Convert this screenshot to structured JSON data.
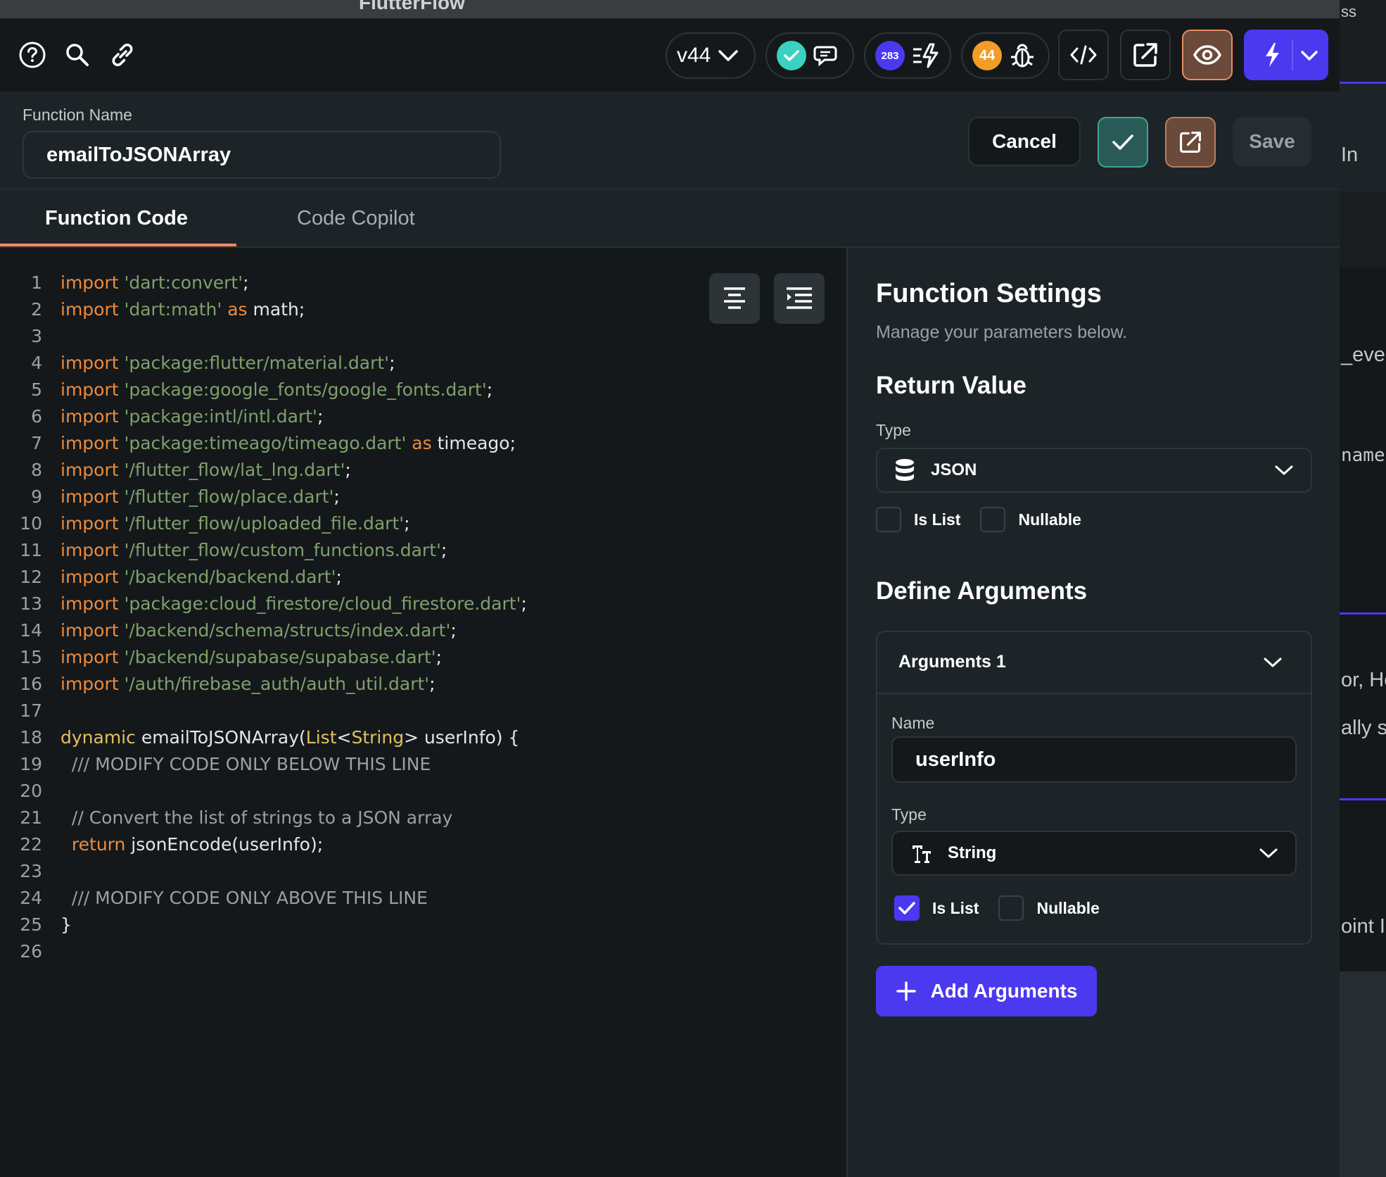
{
  "window": {
    "title": "FlutterFlow"
  },
  "toolbar": {
    "version": "v44",
    "issues_count": "283",
    "bugs_count": "44"
  },
  "function": {
    "name_label": "Function Name",
    "name_value": "emailToJSONArray",
    "cancel_label": "Cancel",
    "save_label": "Save"
  },
  "tabs": [
    {
      "label": "Function Code"
    },
    {
      "label": "Code Copilot"
    }
  ],
  "code": {
    "lines": [
      "1",
      "2",
      "3",
      "4",
      "5",
      "6",
      "7",
      "8",
      "9",
      "10",
      "11",
      "12",
      "13",
      "14",
      "15",
      "16",
      "17",
      "18",
      "19",
      "20",
      "21",
      "22",
      "23",
      "24",
      "25",
      "26"
    ],
    "imports": [
      {
        "path": "'dart:convert'",
        "suffix": ";"
      },
      {
        "path": "'dart:math'",
        "alias": "math",
        "suffix": ";"
      },
      {
        "path": "'package:flutter/material.dart'",
        "suffix": ";"
      },
      {
        "path": "'package:google_fonts/google_fonts.dart'",
        "suffix": ";"
      },
      {
        "path": "'package:intl/intl.dart'",
        "suffix": ";"
      },
      {
        "path": "'package:timeago/timeago.dart'",
        "alias": "timeago",
        "suffix": ";"
      },
      {
        "path": "'/flutter_flow/lat_lng.dart'",
        "suffix": ";"
      },
      {
        "path": "'/flutter_flow/place.dart'",
        "suffix": ";"
      },
      {
        "path": "'/flutter_flow/uploaded_file.dart'",
        "suffix": ";"
      },
      {
        "path": "'/flutter_flow/custom_functions.dart'",
        "suffix": ";"
      },
      {
        "path": "'/backend/backend.dart'",
        "suffix": ";"
      },
      {
        "path": "'package:cloud_firestore/cloud_firestore.dart'",
        "suffix": ";"
      },
      {
        "path": "'/backend/schema/structs/index.dart'",
        "suffix": ";"
      },
      {
        "path": "'/backend/supabase/supabase.dart'",
        "suffix": ";"
      },
      {
        "path": "'/auth/firebase_auth/auth_util.dart'",
        "suffix": ";"
      }
    ],
    "kw_import": "import",
    "kw_as": "as",
    "kw_dynamic": "dynamic",
    "fn_signature_name": " emailToJSONArray(",
    "type_list": "List",
    "type_lt": "<",
    "type_string": "String",
    "sig_rest": "> userInfo) {",
    "comment_below": "/// MODIFY CODE ONLY BELOW THIS LINE",
    "comment_convert": "// Convert the list of strings to a JSON array",
    "kw_return": "return",
    "return_expr": " jsonEncode(userInfo);",
    "comment_above": "/// MODIFY CODE ONLY ABOVE THIS LINE",
    "closing_brace": "}"
  },
  "settings": {
    "title": "Function Settings",
    "subtitle": "Manage your parameters below.",
    "return_value_heading": "Return Value",
    "type_label": "Type",
    "return_type": "JSON",
    "is_list_label": "Is List",
    "nullable_label": "Nullable",
    "define_arguments_heading": "Define Arguments",
    "argument": {
      "header": "Arguments 1",
      "name_label": "Name",
      "name_value": "userInfo",
      "type_label": "Type",
      "type_value": "String",
      "is_list_checked": true,
      "nullable_checked": false
    },
    "add_arguments_label": "Add Arguments"
  },
  "background_fragments": [
    "ss",
    "In",
    "_ever",
    "name",
    "or, He",
    "ally s",
    "oint I"
  ],
  "colors": {
    "accent": "#4b39ef",
    "tab_underline": "#ee8b60",
    "success": "#39d2c0",
    "warning": "#ee8b3a"
  }
}
